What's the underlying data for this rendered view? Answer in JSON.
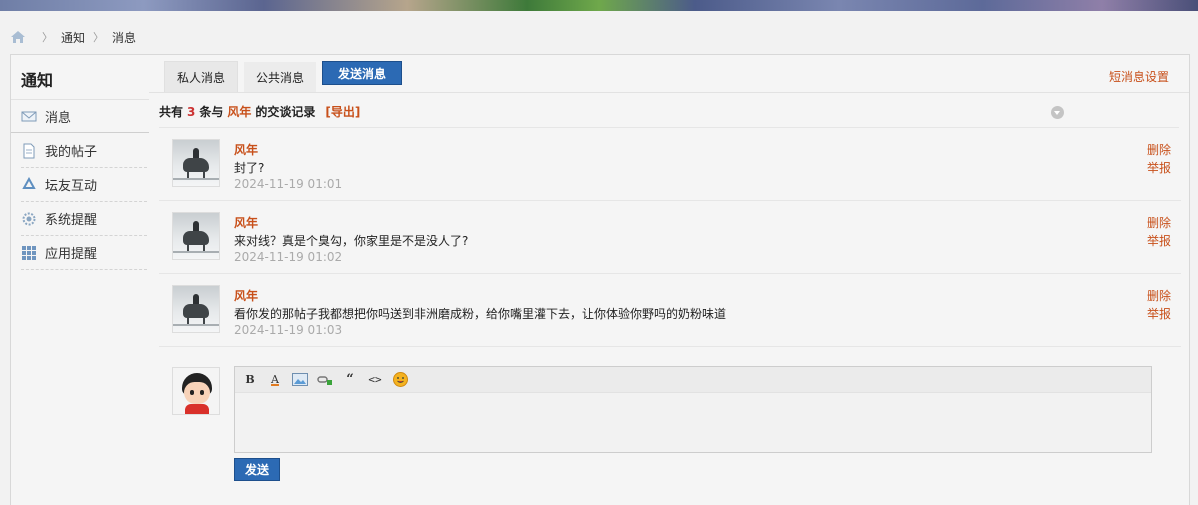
{
  "breadcrumb": [
    "通知",
    "消息"
  ],
  "sidebar": {
    "title": "通知",
    "items": [
      {
        "label": "消息",
        "icon": "envelope-icon"
      },
      {
        "label": "我的帖子",
        "icon": "document-icon"
      },
      {
        "label": "坛友互动",
        "icon": "recycle-icon"
      },
      {
        "label": "系统提醒",
        "icon": "gear-icon"
      },
      {
        "label": "应用提醒",
        "icon": "grid-icon"
      }
    ]
  },
  "tabs": [
    {
      "label": "私人消息",
      "active": true
    },
    {
      "label": "公共消息",
      "active": false
    }
  ],
  "send_message_button": "发送消息",
  "settings_link": "短消息设置",
  "summary": {
    "prefix": "共有",
    "count": "3",
    "mid": "条与",
    "user": "风年",
    "suffix": "的交谈记录",
    "export": "[导出]"
  },
  "messages": [
    {
      "author": "风年",
      "text": "封了?",
      "time": "2024-11-19 01:01",
      "delete": "删除",
      "report": "举报"
    },
    {
      "author": "风年",
      "text": "来对线？真是个臭勾，你家里是不是没人了?",
      "time": "2024-11-19 01:02",
      "delete": "删除",
      "report": "举报"
    },
    {
      "author": "风年",
      "text": "看你发的那帖子我都想把你吗送到非洲磨成粉，给你嘴里灌下去，让你体验你野吗的奶粉味道",
      "time": "2024-11-19 01:03",
      "delete": "删除",
      "report": "举报"
    }
  ],
  "editor": {
    "tools": [
      {
        "name": "bold-icon",
        "glyph": "B"
      },
      {
        "name": "font-color-icon",
        "glyph": "A"
      },
      {
        "name": "image-icon",
        "glyph": ""
      },
      {
        "name": "link-icon",
        "glyph": ""
      },
      {
        "name": "quote-icon",
        "glyph": "“"
      },
      {
        "name": "code-icon",
        "glyph": "<>"
      },
      {
        "name": "emoji-icon",
        "glyph": ""
      }
    ],
    "send_label": "发送"
  },
  "colors": {
    "accent": "#c8501a",
    "button": "#2c6ab4",
    "count": "#cc3333"
  }
}
